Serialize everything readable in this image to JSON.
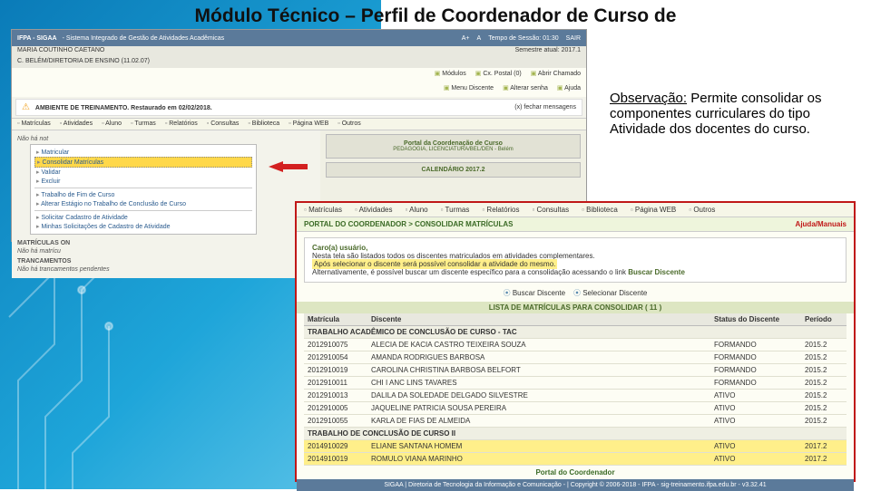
{
  "slide": {
    "title": "Módulo Técnico – Perfil de Coordenador de Curso de"
  },
  "obs": {
    "title": "Observação:",
    "text": "Permite consolidar os componentes curriculares do tipo Atividade dos docentes do curso."
  },
  "shot1": {
    "topbar": {
      "left": "IFPA - SIGAA",
      "left2": "- Sistema Integrado de Gestão de Atividades Acadêmicas",
      "r1": "A+",
      "r2": "A",
      "r3": "Tempo de Sessão: 01:30",
      "r4": "SAIR"
    },
    "subbar": {
      "left": "MARIA COUTINHO CAETANO",
      "left2": "C. BELÉM/DIRETORIA DE ENSINO (11.02.07)",
      "right": "Semestre atual: 2017.1"
    },
    "iconrow": [
      "Módulos",
      "Cx. Postal (0)",
      "Abrir Chamado",
      "Menu Discente",
      "Alterar senha",
      "Ajuda"
    ],
    "warn": {
      "text": "AMBIENTE DE TREINAMENTO. Restaurado em 02/02/2018.",
      "close": "(x) fechar mensagens"
    },
    "tabs": [
      "Matrículas",
      "Atividades",
      "Aluno",
      "Turmas",
      "Relatórios",
      "Consultas",
      "Biblioteca",
      "Página WEB",
      "Outros"
    ],
    "left": {
      "hdr": "Não há not",
      "dropdown": [
        "Matricular",
        "Consolidar Matrículas",
        "Validar",
        "Excluir",
        "Trabalho de Fim de Curso",
        "Alterar Estágio no Trabalho de Conclusão de Curso",
        "Solicitar Cadastro de Atividade",
        "Minhas Solicitações de Cadastro de Atividade"
      ],
      "hlIndex": 1,
      "sect1": "MATRÍCULAS ON",
      "sect1b": "Não há matrícu",
      "sect2": "TRANCAMENTOS",
      "sect2b": "Não há trancamentos pendentes"
    },
    "right": {
      "portal": "Portal da Coordenação de Curso",
      "portalSub": "PEDAGOGIA, LICENCIATURA/BEL/DEN - Belém",
      "cal": "CALENDÁRIO 2017.2"
    }
  },
  "shot2": {
    "tabs": [
      "Matrículas",
      "Atividades",
      "Aluno",
      "Turmas",
      "Relatórios",
      "Consultas",
      "Biblioteca",
      "Página WEB",
      "Outros"
    ],
    "breadcrumb": "PORTAL DO COORDENADOR > CONSOLIDAR MATRÍCULAS",
    "help": "Ajuda/Manuais",
    "msg": {
      "greet": "Caro(a) usuário,",
      "l1": "Nesta tela são listados todos os discentes matriculados em atividades complementares.",
      "l2": "Após selecionar o discente será possível consolidar a atividade do mesmo.",
      "l3a": "Alternativamente, é possível buscar um discente específico para a consolidação acessando o link ",
      "l3b": "Buscar Discente"
    },
    "actions": {
      "a1": "Buscar Discente",
      "a2": "Selecionar Discente"
    },
    "listhdr": "LISTA DE MATRÍCULAS PARA CONSOLIDAR ( 11 )",
    "cols": [
      "Matrícula",
      "Discente",
      "Status do Discente",
      "Período"
    ],
    "section1": "TRABALHO ACADÊMICO DE CONCLUSÃO DE CURSO - TAC",
    "rows1": [
      {
        "m": "2012910075",
        "d": "ALECIA DE KACIA CASTRO TEIXEIRA SOUZA",
        "s": "FORMANDO",
        "p": "2015.2"
      },
      {
        "m": "2012910054",
        "d": "AMANDA RODRIGUES BARBOSA",
        "s": "FORMANDO",
        "p": "2015.2"
      },
      {
        "m": "2012910019",
        "d": "CAROLINA CHRISTINA BARBOSA BELFORT",
        "s": "FORMANDO",
        "p": "2015.2"
      },
      {
        "m": "2012910011",
        "d": "CHI I ANC LINS TAVARES",
        "s": "FORMANDO",
        "p": "2015.2"
      },
      {
        "m": "2012910013",
        "d": "DALILA DA SOLEDADE DELGADO SILVESTRE",
        "s": "ATIVO",
        "p": "2015.2"
      },
      {
        "m": "2012910005",
        "d": "JAQUELINE PATRICIA SOUSA PEREIRA",
        "s": "ATIVO",
        "p": "2015.2"
      },
      {
        "m": "2012910055",
        "d": "KARLA DE FIAS DE ALMEIDA",
        "s": "ATIVO",
        "p": "2015.2"
      }
    ],
    "section2": "TRABALHO DE CONCLUSÃO DE CURSO II",
    "rows2": [
      {
        "m": "2014910029",
        "d": "ELIANE SANTANA HOMEM",
        "s": "ATIVO",
        "p": "2017.2"
      },
      {
        "m": "2014910019",
        "d": "ROMULO VIANA MARINHO",
        "s": "ATIVO",
        "p": "2017.2"
      }
    ],
    "portalLink": "Portal do Coordenador",
    "footer": "SIGAA | Diretoria de Tecnologia da Informação e Comunicação - | Copyright © 2006-2018 - IFPA - sig-treinamento.ifpa.edu.br - v3.32.41"
  }
}
